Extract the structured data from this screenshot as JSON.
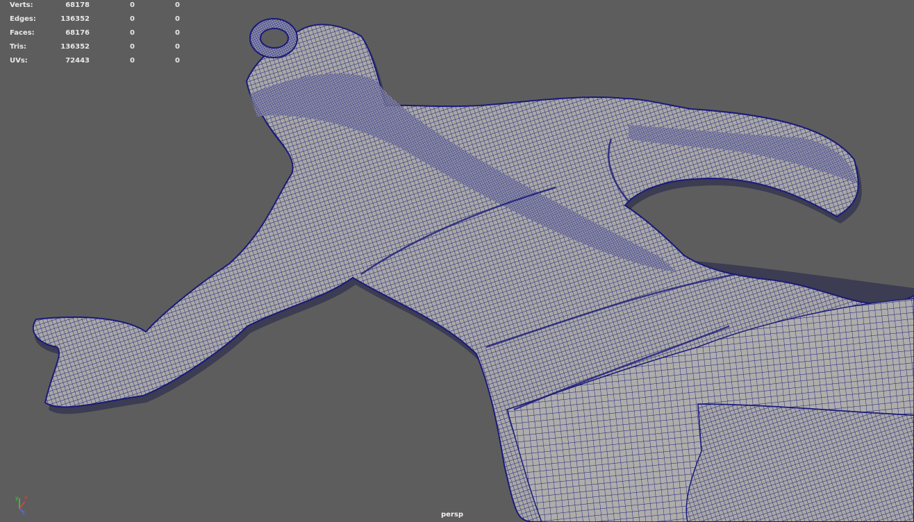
{
  "hud": {
    "rows": [
      {
        "label": "Verts:",
        "values": [
          "68178",
          "0",
          "0"
        ]
      },
      {
        "label": "Edges:",
        "values": [
          "136352",
          "0",
          "0"
        ]
      },
      {
        "label": "Faces:",
        "values": [
          "68176",
          "0",
          "0"
        ]
      },
      {
        "label": "Tris:",
        "values": [
          "136352",
          "0",
          "0"
        ]
      },
      {
        "label": "UVs:",
        "values": [
          "72443",
          "0",
          "0"
        ]
      }
    ]
  },
  "camera": {
    "name": "persp"
  },
  "axis": {
    "x": "x",
    "y": "y",
    "z": "z"
  },
  "colors": {
    "background": "#5d5d5d",
    "surface": "#a9a8a6",
    "wireframe": "#1a1a7a",
    "hud_text": "#e8e8e8",
    "axis_x": "#e04040",
    "axis_y": "#40d040",
    "axis_z": "#4a70ff"
  }
}
